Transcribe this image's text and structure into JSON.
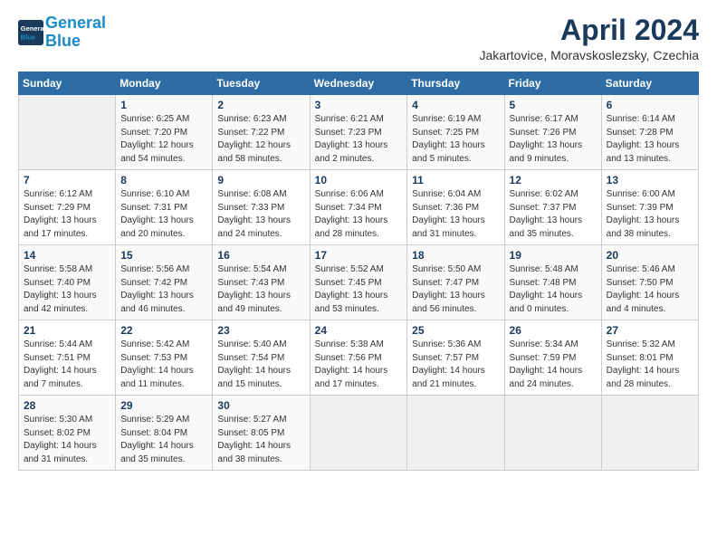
{
  "logo": {
    "line1": "General",
    "line2": "Blue"
  },
  "header": {
    "month_year": "April 2024",
    "location": "Jakartovice, Moravskoslezsky, Czechia"
  },
  "days_of_week": [
    "Sunday",
    "Monday",
    "Tuesday",
    "Wednesday",
    "Thursday",
    "Friday",
    "Saturday"
  ],
  "weeks": [
    [
      {
        "day": "",
        "info": ""
      },
      {
        "day": "1",
        "info": "Sunrise: 6:25 AM\nSunset: 7:20 PM\nDaylight: 12 hours\nand 54 minutes."
      },
      {
        "day": "2",
        "info": "Sunrise: 6:23 AM\nSunset: 7:22 PM\nDaylight: 12 hours\nand 58 minutes."
      },
      {
        "day": "3",
        "info": "Sunrise: 6:21 AM\nSunset: 7:23 PM\nDaylight: 13 hours\nand 2 minutes."
      },
      {
        "day": "4",
        "info": "Sunrise: 6:19 AM\nSunset: 7:25 PM\nDaylight: 13 hours\nand 5 minutes."
      },
      {
        "day": "5",
        "info": "Sunrise: 6:17 AM\nSunset: 7:26 PM\nDaylight: 13 hours\nand 9 minutes."
      },
      {
        "day": "6",
        "info": "Sunrise: 6:14 AM\nSunset: 7:28 PM\nDaylight: 13 hours\nand 13 minutes."
      }
    ],
    [
      {
        "day": "7",
        "info": "Sunrise: 6:12 AM\nSunset: 7:29 PM\nDaylight: 13 hours\nand 17 minutes."
      },
      {
        "day": "8",
        "info": "Sunrise: 6:10 AM\nSunset: 7:31 PM\nDaylight: 13 hours\nand 20 minutes."
      },
      {
        "day": "9",
        "info": "Sunrise: 6:08 AM\nSunset: 7:33 PM\nDaylight: 13 hours\nand 24 minutes."
      },
      {
        "day": "10",
        "info": "Sunrise: 6:06 AM\nSunset: 7:34 PM\nDaylight: 13 hours\nand 28 minutes."
      },
      {
        "day": "11",
        "info": "Sunrise: 6:04 AM\nSunset: 7:36 PM\nDaylight: 13 hours\nand 31 minutes."
      },
      {
        "day": "12",
        "info": "Sunrise: 6:02 AM\nSunset: 7:37 PM\nDaylight: 13 hours\nand 35 minutes."
      },
      {
        "day": "13",
        "info": "Sunrise: 6:00 AM\nSunset: 7:39 PM\nDaylight: 13 hours\nand 38 minutes."
      }
    ],
    [
      {
        "day": "14",
        "info": "Sunrise: 5:58 AM\nSunset: 7:40 PM\nDaylight: 13 hours\nand 42 minutes."
      },
      {
        "day": "15",
        "info": "Sunrise: 5:56 AM\nSunset: 7:42 PM\nDaylight: 13 hours\nand 46 minutes."
      },
      {
        "day": "16",
        "info": "Sunrise: 5:54 AM\nSunset: 7:43 PM\nDaylight: 13 hours\nand 49 minutes."
      },
      {
        "day": "17",
        "info": "Sunrise: 5:52 AM\nSunset: 7:45 PM\nDaylight: 13 hours\nand 53 minutes."
      },
      {
        "day": "18",
        "info": "Sunrise: 5:50 AM\nSunset: 7:47 PM\nDaylight: 13 hours\nand 56 minutes."
      },
      {
        "day": "19",
        "info": "Sunrise: 5:48 AM\nSunset: 7:48 PM\nDaylight: 14 hours\nand 0 minutes."
      },
      {
        "day": "20",
        "info": "Sunrise: 5:46 AM\nSunset: 7:50 PM\nDaylight: 14 hours\nand 4 minutes."
      }
    ],
    [
      {
        "day": "21",
        "info": "Sunrise: 5:44 AM\nSunset: 7:51 PM\nDaylight: 14 hours\nand 7 minutes."
      },
      {
        "day": "22",
        "info": "Sunrise: 5:42 AM\nSunset: 7:53 PM\nDaylight: 14 hours\nand 11 minutes."
      },
      {
        "day": "23",
        "info": "Sunrise: 5:40 AM\nSunset: 7:54 PM\nDaylight: 14 hours\nand 15 minutes."
      },
      {
        "day": "24",
        "info": "Sunrise: 5:38 AM\nSunset: 7:56 PM\nDaylight: 14 hours\nand 17 minutes."
      },
      {
        "day": "25",
        "info": "Sunrise: 5:36 AM\nSunset: 7:57 PM\nDaylight: 14 hours\nand 21 minutes."
      },
      {
        "day": "26",
        "info": "Sunrise: 5:34 AM\nSunset: 7:59 PM\nDaylight: 14 hours\nand 24 minutes."
      },
      {
        "day": "27",
        "info": "Sunrise: 5:32 AM\nSunset: 8:01 PM\nDaylight: 14 hours\nand 28 minutes."
      }
    ],
    [
      {
        "day": "28",
        "info": "Sunrise: 5:30 AM\nSunset: 8:02 PM\nDaylight: 14 hours\nand 31 minutes."
      },
      {
        "day": "29",
        "info": "Sunrise: 5:29 AM\nSunset: 8:04 PM\nDaylight: 14 hours\nand 35 minutes."
      },
      {
        "day": "30",
        "info": "Sunrise: 5:27 AM\nSunset: 8:05 PM\nDaylight: 14 hours\nand 38 minutes."
      },
      {
        "day": "",
        "info": ""
      },
      {
        "day": "",
        "info": ""
      },
      {
        "day": "",
        "info": ""
      },
      {
        "day": "",
        "info": ""
      }
    ]
  ]
}
